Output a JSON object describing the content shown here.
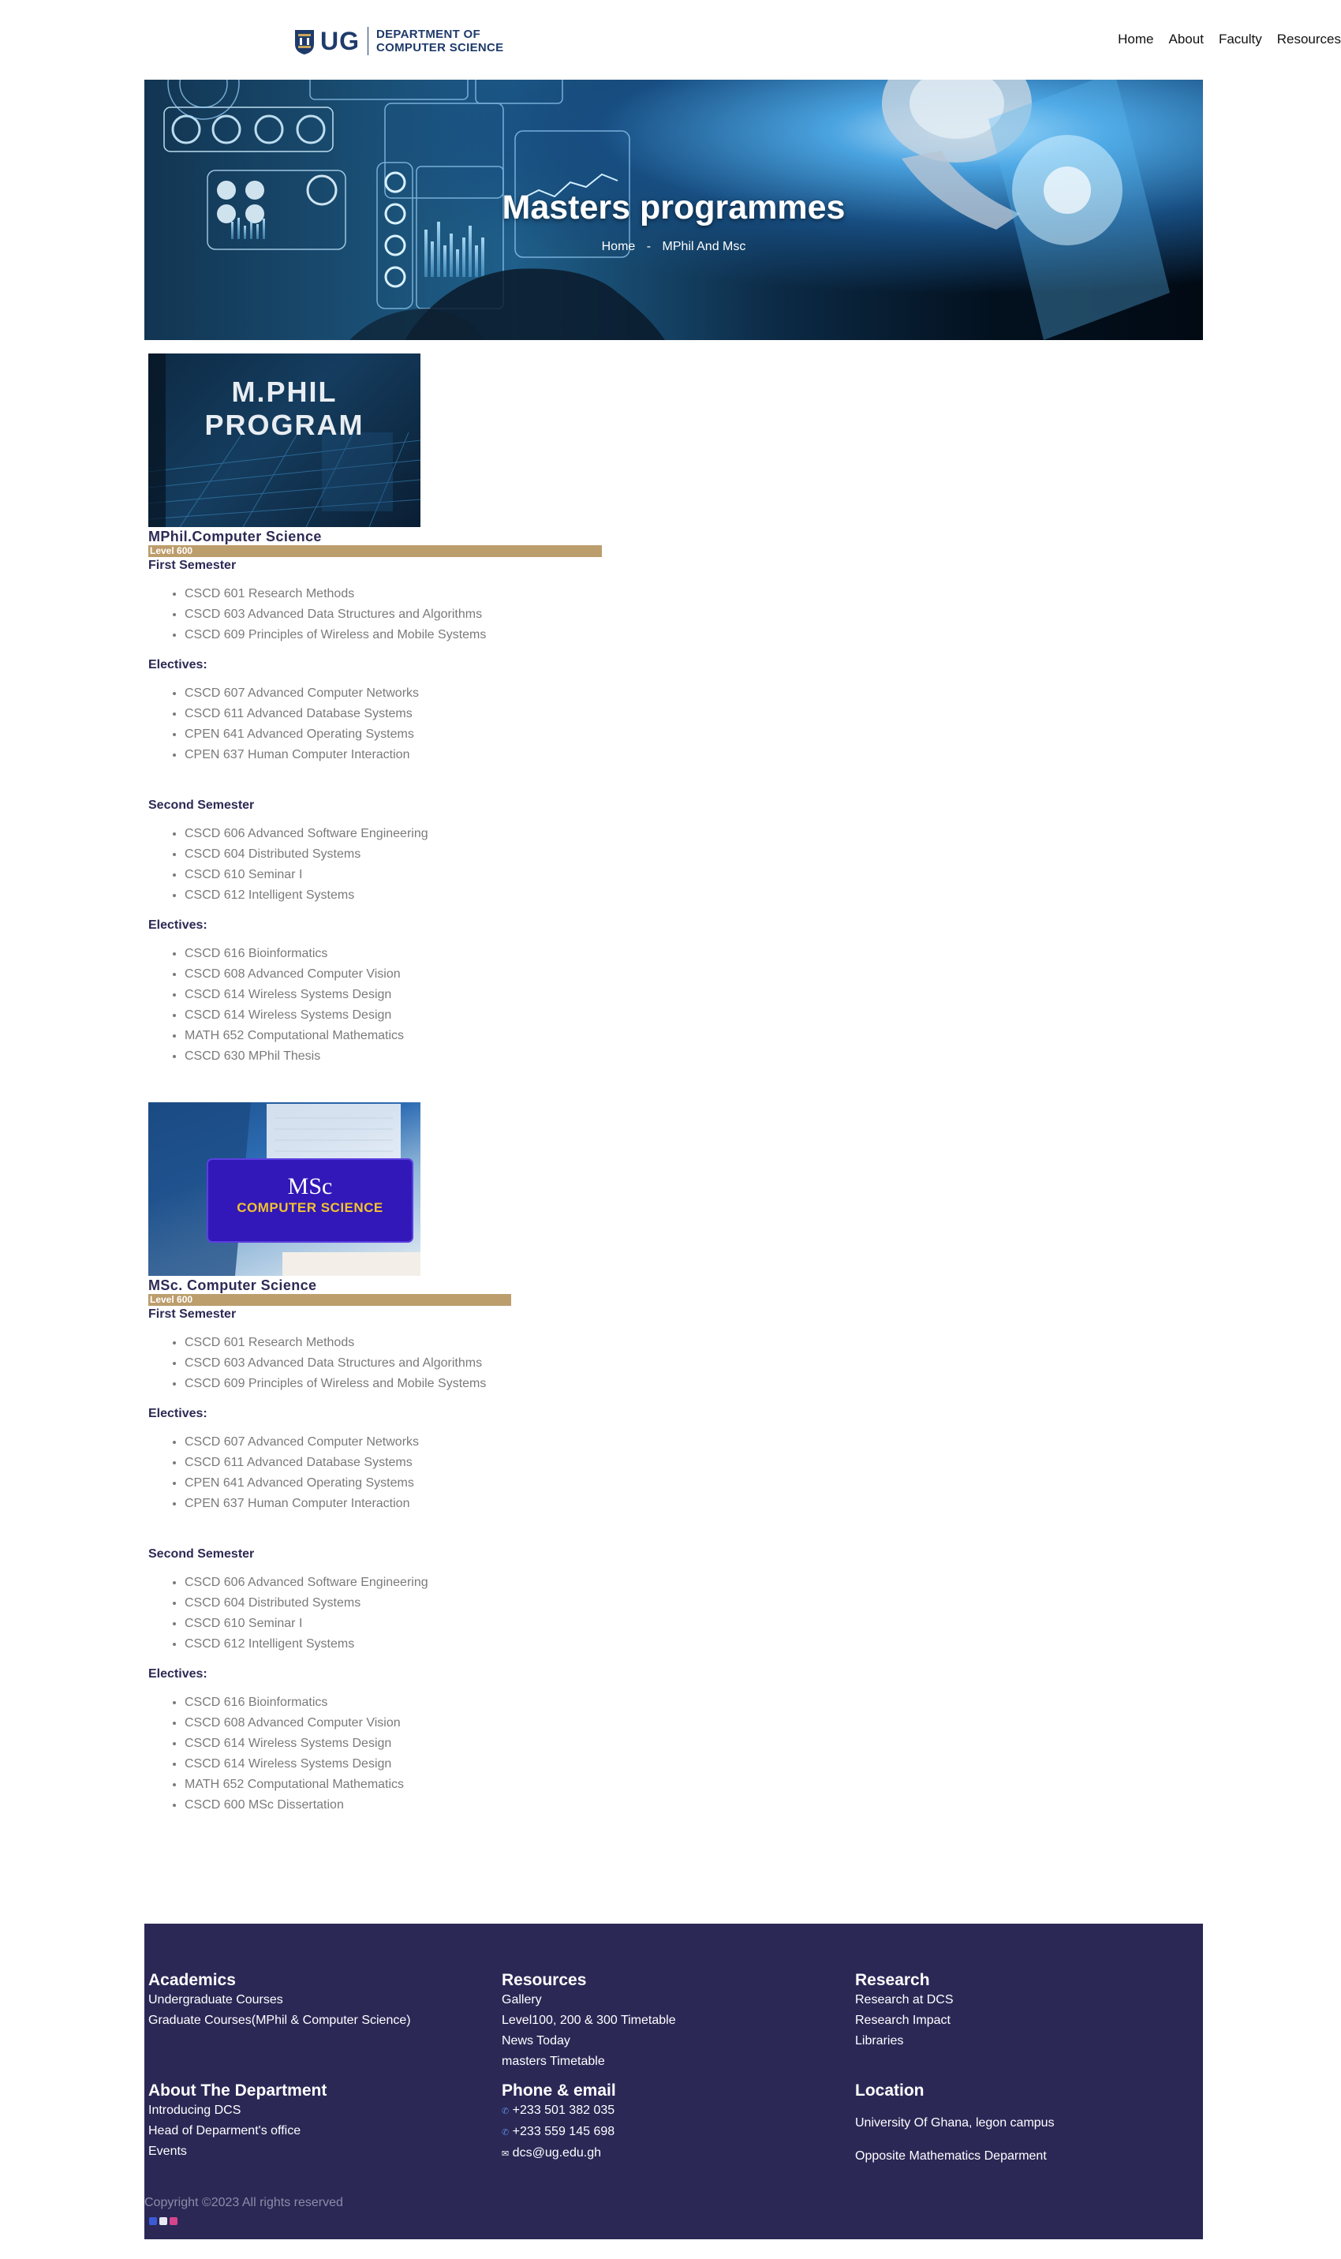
{
  "header": {
    "logo_short": "UG",
    "logo_line1": "DEPARTMENT OF",
    "logo_line2": "COMPUTER SCIENCE",
    "nav": [
      "Home",
      "About",
      "Faculty",
      "Resources"
    ]
  },
  "hero": {
    "title": "Masters programmes",
    "breadcrumb_home": "Home",
    "breadcrumb_sep": "-",
    "breadcrumb_current": "MPhil And Msc"
  },
  "mphil": {
    "image_line1": "M.PHIL",
    "image_line2": "PROGRAM",
    "title": "MPhil.Computer Science",
    "level": "Level 600",
    "first_semester": "First Semester",
    "first_courses": [
      "CSCD 601 Research Methods",
      "CSCD 603 Advanced Data Structures and Algorithms",
      "CSCD 609 Principles of Wireless and Mobile Systems"
    ],
    "electives_label": "Electives:",
    "first_electives": [
      "CSCD 607 Advanced Computer Networks",
      "CSCD 611 Advanced Database Systems",
      "CPEN 641 Advanced Operating Systems",
      "CPEN 637 Human Computer Interaction"
    ],
    "second_semester": "Second Semester",
    "second_courses": [
      "CSCD 606 Advanced Software Engineering",
      "CSCD 604 Distributed Systems",
      "CSCD 610 Seminar I",
      "CSCD 612 Intelligent Systems"
    ],
    "second_electives": [
      "CSCD 616 Bioinformatics",
      "CSCD 608 Advanced Computer Vision",
      "CSCD 614 Wireless Systems Design",
      "CSCD 614 Wireless Systems Design",
      "MATH 652 Computational Mathematics",
      "CSCD 630 MPhil Thesis"
    ]
  },
  "msc": {
    "image_line1": "MSc",
    "image_line2": "COMPUTER SCIENCE",
    "title": "MSc. Computer Science",
    "level": "Level 600",
    "first_semester": "First Semester",
    "first_courses": [
      "CSCD 601 Research Methods",
      "CSCD 603 Advanced Data Structures and Algorithms",
      "CSCD 609 Principles of Wireless and Mobile Systems"
    ],
    "electives_label": "Electives:",
    "first_electives": [
      "CSCD 607 Advanced Computer Networks",
      "CSCD 611 Advanced Database Systems",
      "CPEN 641 Advanced Operating Systems",
      "CPEN 637 Human Computer Interaction"
    ],
    "second_semester": "Second Semester",
    "second_courses": [
      "CSCD 606 Advanced Software Engineering",
      "CSCD 604 Distributed Systems",
      "CSCD 610 Seminar I",
      "CSCD 612 Intelligent Systems"
    ],
    "second_electives": [
      "CSCD 616 Bioinformatics",
      "CSCD 608 Advanced Computer Vision",
      "CSCD 614 Wireless Systems Design",
      "CSCD 614 Wireless Systems Design",
      "MATH 652 Computational Mathematics",
      "CSCD 600 MSc Dissertation"
    ]
  },
  "footer": {
    "academics": {
      "title": "Academics",
      "links": [
        "Undergraduate Courses",
        "Graduate Courses(MPhil & Computer Science)"
      ]
    },
    "resources": {
      "title": "Resources",
      "links": [
        "Gallery",
        "Level100, 200 & 300 Timetable",
        "News Today",
        "masters Timetable"
      ]
    },
    "research": {
      "title": "Research",
      "links": [
        "Research at DCS",
        "Research Impact",
        "Libraries"
      ]
    },
    "about": {
      "title": "About The Department",
      "links": [
        "Introducing DCS",
        "Head of Deparment's office",
        "Events"
      ]
    },
    "contact": {
      "title": "Phone & email",
      "phone1": "+233 501 382 035",
      "phone2": "+233 559 145 698",
      "email": "dcs@ug.edu.gh"
    },
    "location": {
      "title": "Location",
      "line1": "University Of Ghana, legon campus",
      "line2": "Opposite Mathematics Deparment"
    },
    "copyright": "Copyright ©2023 All rights reserved"
  },
  "colors": {
    "brand_navy": "#1f3b6b",
    "footer_bg": "#2b2856",
    "level_bar": "#bc9d6c",
    "heading": "#2d2a55"
  },
  "icons": [
    "phone-icon",
    "email-icon",
    "facebook-icon",
    "twitter-icon",
    "instagram-icon"
  ]
}
